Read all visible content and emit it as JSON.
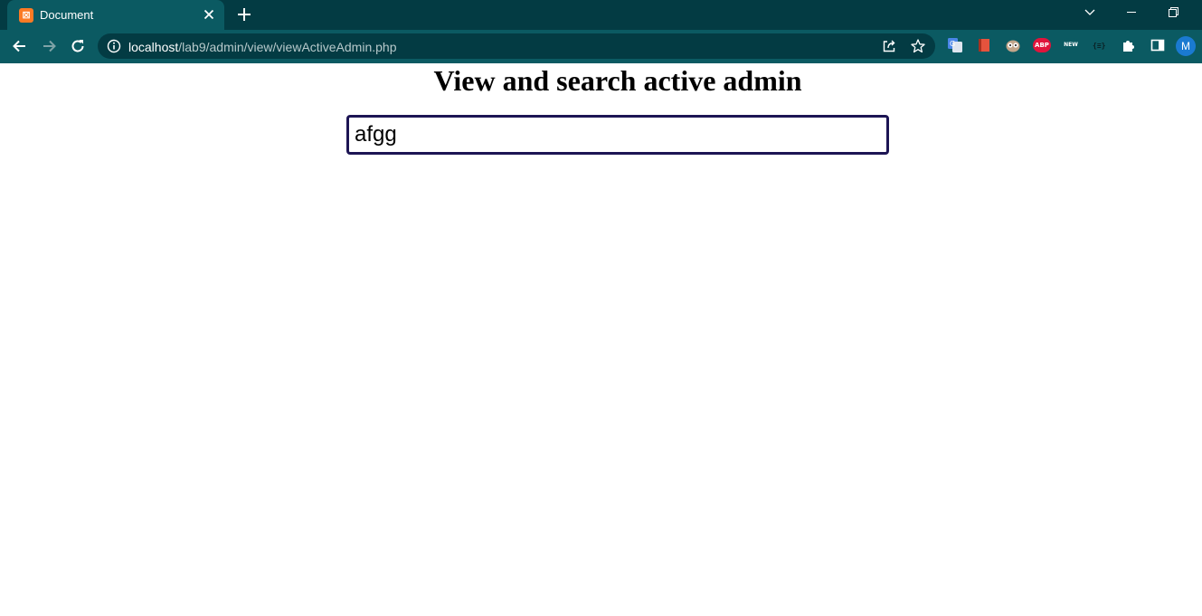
{
  "browser": {
    "tab_title": "Document",
    "favicon_glyph": "⊠",
    "url_host": "localhost",
    "url_path": "/lab9/admin/view/viewActiveAdmin.php",
    "extensions": [
      "google-translate-icon",
      "bookmark-red-icon",
      "owl-icon",
      "adblock-icon",
      "new-badge-icon",
      "devtools-icon",
      "puzzle-icon",
      "side-panel-icon"
    ],
    "abp_label": "ABP",
    "new_label": "NEW",
    "profile_initial": "M"
  },
  "page": {
    "title": "View and search active admin",
    "search": {
      "value": "afgg",
      "placeholder": ""
    }
  },
  "colors": {
    "tabstrip": "#033b43",
    "toolbar": "#0b5a62",
    "input_border": "#1d1554",
    "avatar": "#1a7ad1"
  }
}
